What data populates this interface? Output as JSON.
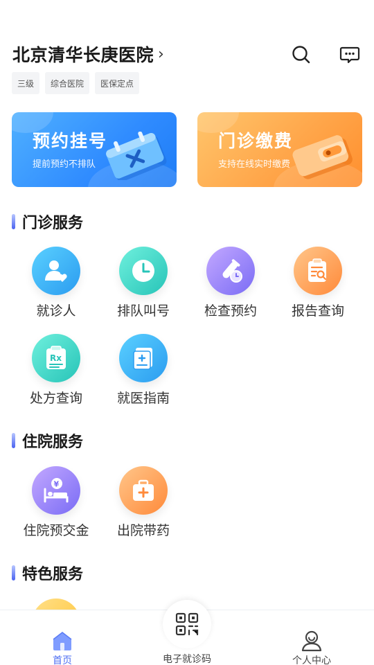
{
  "header": {
    "hospital_name": "北京清华长庚医院",
    "chevron": "›",
    "search_icon": "search-icon",
    "message_icon": "message-icon"
  },
  "tags": [
    "三级",
    "综合医院",
    "医保定点"
  ],
  "banners": {
    "appointment": {
      "title": "预约挂号",
      "subtitle": "提前预约不排队"
    },
    "payment": {
      "title": "门诊缴费",
      "subtitle": "支持在线实时缴费"
    }
  },
  "sections": {
    "outpatient": {
      "title": "门诊服务",
      "items": [
        {
          "label": "就诊人",
          "icon": "patient-icon"
        },
        {
          "label": "排队叫号",
          "icon": "clock-icon"
        },
        {
          "label": "检查预约",
          "icon": "test-tube-icon"
        },
        {
          "label": "报告查询",
          "icon": "report-search-icon"
        },
        {
          "label": "处方查询",
          "icon": "prescription-icon"
        },
        {
          "label": "就医指南",
          "icon": "guide-book-icon"
        }
      ]
    },
    "inpatient": {
      "title": "住院服务",
      "items": [
        {
          "label": "住院预交金",
          "icon": "deposit-bed-icon"
        },
        {
          "label": "出院带药",
          "icon": "medicine-kit-icon"
        }
      ]
    },
    "featured": {
      "title": "特色服务"
    }
  },
  "colors": {
    "accent": "#4d6ef2",
    "blue_banner": "#2f8bff",
    "orange_banner": "#ffa64a"
  },
  "tabbar": {
    "home": {
      "label": "首页",
      "icon": "home-icon"
    },
    "qr": {
      "label": "电子就诊码",
      "icon": "qr-code-icon"
    },
    "profile": {
      "label": "个人中心",
      "icon": "user-icon"
    }
  }
}
